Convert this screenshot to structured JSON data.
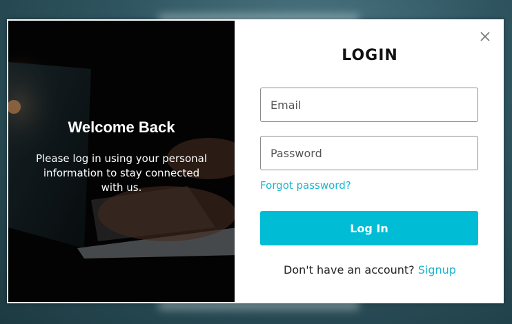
{
  "left_panel": {
    "title": "Welcome Back",
    "description": "Please log in using your personal information to stay connected with us."
  },
  "login": {
    "title": "LOGIN",
    "email_placeholder": "Email",
    "password_placeholder": "Password",
    "forgot_password": "Forgot password?",
    "login_button": "Log In",
    "signup_prompt": "Don't have an account?",
    "signup_link": "Signup"
  },
  "icons": {
    "close": "close-icon"
  },
  "colors": {
    "accent": "#00bcd4",
    "link": "#19b5d0",
    "text": "#111111"
  }
}
